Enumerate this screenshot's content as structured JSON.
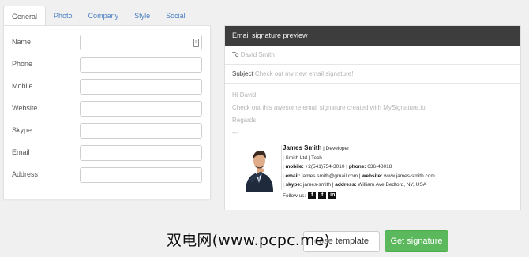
{
  "tabs": [
    "General",
    "Photo",
    "Company",
    "Style",
    "Social"
  ],
  "form": {
    "fields": [
      "Name",
      "Phone",
      "Mobile",
      "Website",
      "Skype",
      "Email",
      "Address"
    ]
  },
  "preview": {
    "header": "Email signature preview",
    "to_label": "To",
    "to_value": "David Smith",
    "subject_label": "Subject",
    "subject_value": "Check out my new email signature!",
    "body": [
      "Hi David,",
      "Check out this awesome email signature created with MySignature.io",
      "Regards,",
      "---"
    ]
  },
  "signature": {
    "name": "James Smith",
    "title": "| Developer",
    "company": "| Smith Ltd | Tech",
    "mobile_label": "mobile:",
    "mobile": "+2(541)754-3010",
    "phone_label": "phone:",
    "phone": "636-48018",
    "email_label": "email:",
    "email": "james.smith@gmail.com",
    "website_label": "website:",
    "website": "www.james-smith.com",
    "skype_label": "skype:",
    "skype": "james-smith",
    "address_label": "address:",
    "address": "William Ave Bedford, NY, USA",
    "follow_label": "Follow us:",
    "social_icons": [
      "f",
      "t",
      "in"
    ]
  },
  "buttons": {
    "choose_template": "oose template",
    "get_signature": "Get signature"
  },
  "watermark": "双电网(www.pcpc.me)"
}
